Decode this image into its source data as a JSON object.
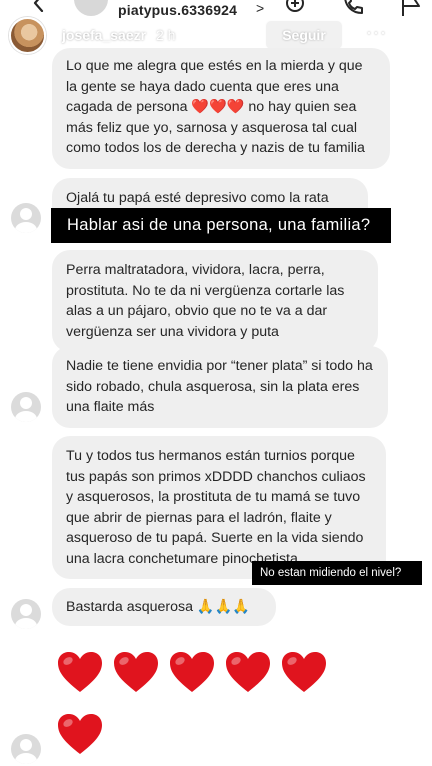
{
  "top_bar": {
    "username": "piatypus.6336924",
    "chevron": ">"
  },
  "story_header": {
    "username": "josefa_saezr",
    "time": "2 h",
    "follow_label": "Seguir",
    "more": "···"
  },
  "messages": [
    {
      "text": "Lo que me alegra que estés en la mierda y que la gente se haya dado cuenta que eres una cagada de persona ❤️❤️❤️ no hay quien sea más feliz que yo, sarnosa y asquerosa tal cual como todos los de derecha y nazis de tu familia"
    },
    {
      "text": "Ojalá tu papá esté depresivo como la rata"
    },
    {
      "text": "Perra maltratadora, vividora, lacra, perra, prostituta. No te da ni vergüenza cortarle las alas a un pájaro, obvio que no te va a dar vergüenza ser una vividora y puta"
    },
    {
      "text": "Nadie te tiene envidia por “tener plata” si todo ha sido robado, chula asquerosa, sin la plata eres una flaite más"
    },
    {
      "text": "Tu y todos tus hermanos están turnios porque tus papás son primos xDDDD chanchos culiaos y asquerosos, la prostituta de tu mamá se tuvo que abrir de piernas para el ladrón, flaite y asqueroso de tu papá. Suerte en la vida siendo una lacra conchetumare pinochetista."
    },
    {
      "text": "Bastarda asquerosa 🙏🙏🙏"
    }
  ],
  "overlays": {
    "caption_large": "Hablar asi de una persona, una familia?",
    "caption_small": "No estan midiendo el nivel?"
  },
  "hearts": {
    "count": 6,
    "color": "#e0141e"
  },
  "colors": {
    "bubble": "#efefef",
    "text": "#262626",
    "heart": "#e0141e"
  }
}
